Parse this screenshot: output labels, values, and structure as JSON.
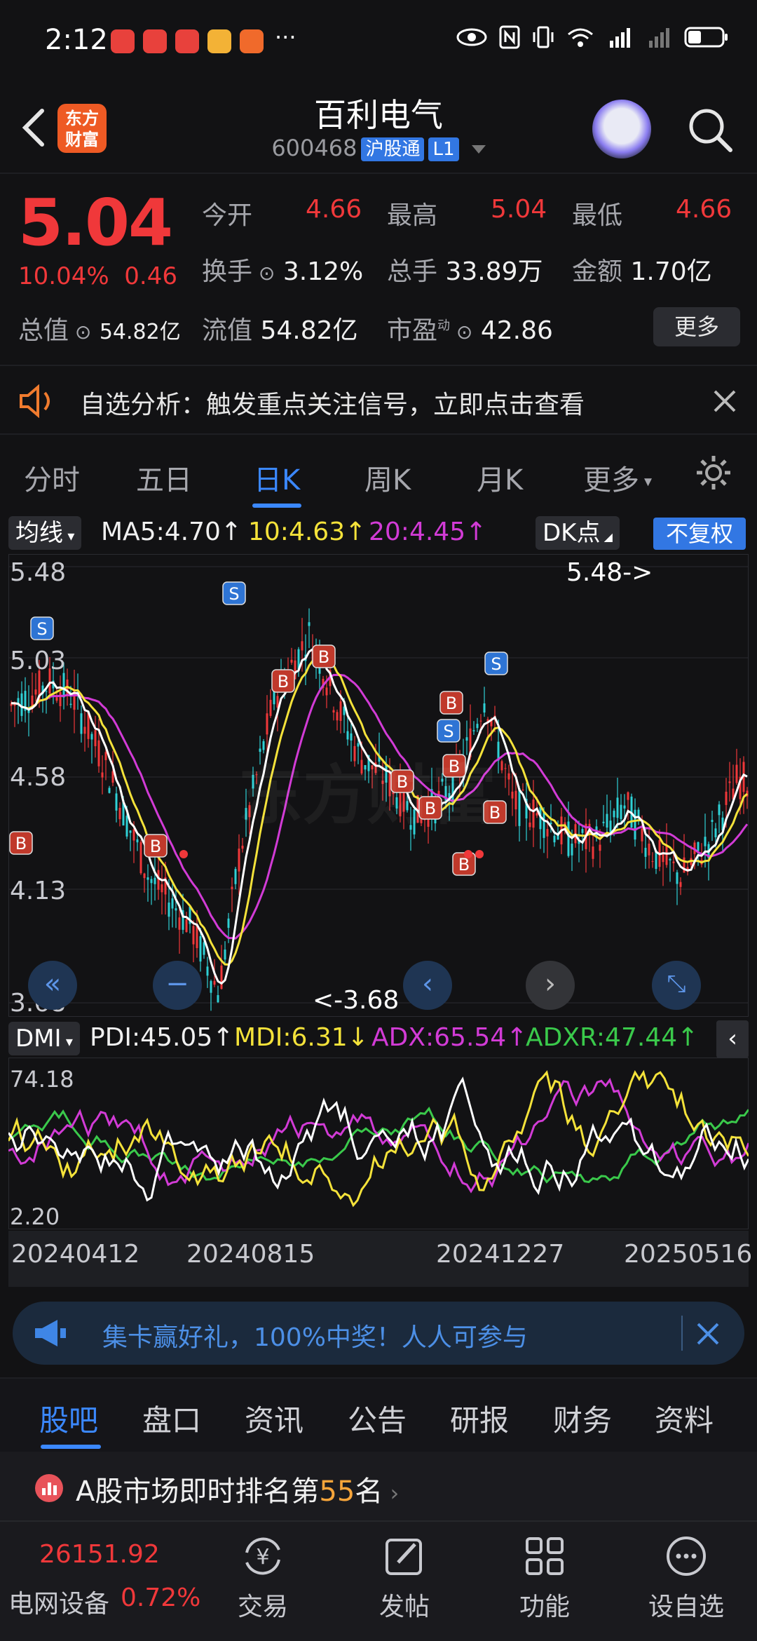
{
  "status_bar": {
    "time": "2:12",
    "ellipsis": "···"
  },
  "header": {
    "title": "百利电气",
    "code": "600468",
    "tag_hgt": "沪股通",
    "tag_level": "L1",
    "logo_line1": "东方",
    "logo_line2": "财富"
  },
  "quote": {
    "price": "5.04",
    "change_pct": "10.04%",
    "change_amt": "0.46",
    "open_label": "今开",
    "open": "4.66",
    "high_label": "最高",
    "high": "5.04",
    "low_label": "最低",
    "low": "4.66",
    "turnover_label": "换手",
    "turnover": "3.12%",
    "volume_label": "总手",
    "volume": "33.89万",
    "amount_label": "金额",
    "amount": "1.70亿",
    "mktcap_label": "总值",
    "mktcap": "54.82亿",
    "float_label": "流值",
    "float": "54.82亿",
    "pe_label": "市盈",
    "pe_sup": "动",
    "pe": "42.86",
    "more": "更多"
  },
  "alert": {
    "text": "自选分析：触发重点关注信号，立即点击查看"
  },
  "period_tabs": [
    "分时",
    "五日",
    "日K",
    "周K",
    "月K",
    "更多"
  ],
  "ma": {
    "selector": "均线",
    "ma5": "MA5:4.70↑",
    "ma10": "10:4.63↑",
    "ma20": "20:4.45↑",
    "dk": "DK点",
    "fq": "不复权"
  },
  "kchart": {
    "y_labels": [
      "5.48",
      "5.03",
      "4.58",
      "4.13",
      "3.68"
    ],
    "high_note": "5.48->",
    "low_note": "<-3.68",
    "watermark": "东方财富"
  },
  "dmi": {
    "selector": "DMI",
    "pdi": "PDI:45.05↑",
    "mdi": "MDI:6.31↓",
    "adx": "ADX:65.54↑",
    "adxr": "ADXR:47.44↑",
    "y_top": "74.18",
    "y_bottom": "2.20"
  },
  "dates": [
    "20240412",
    "20240815",
    "20241227",
    "20250516"
  ],
  "promo": {
    "text": "集卡赢好礼，100%中奖！人人可参与"
  },
  "bottom_tabs": [
    "股吧",
    "盘口",
    "资讯",
    "公告",
    "研报",
    "财务",
    "资料"
  ],
  "rank": {
    "prefix": "A股市场即时排名第",
    "number": "55",
    "suffix": "名"
  },
  "footer": {
    "index_value": "26151.92",
    "index_name": "电网设备",
    "index_pct": "0.72%",
    "items": [
      "交易",
      "发帖",
      "功能",
      "设自选"
    ]
  },
  "colors": {
    "up": "#f0383a",
    "accent": "#3b88ff",
    "bg": "#121214"
  }
}
